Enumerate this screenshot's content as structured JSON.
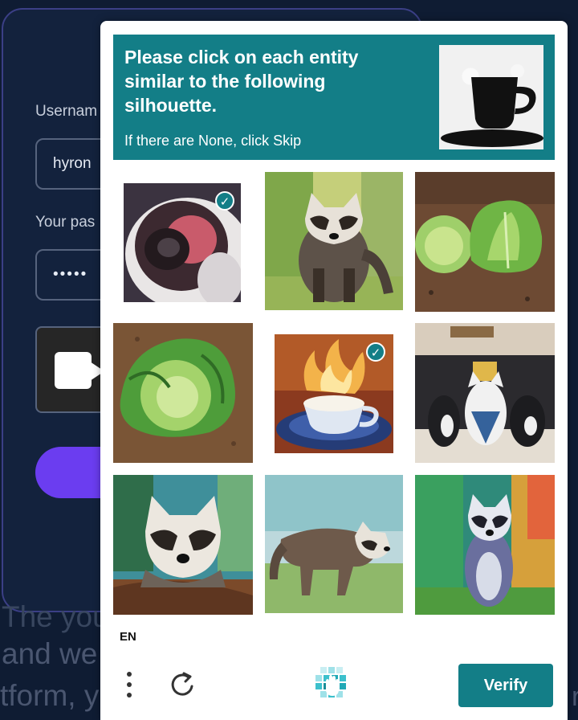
{
  "background": {
    "username_label": "Usernam",
    "username_value": "hyron",
    "password_label": "Your pas",
    "password_value": "•••••",
    "para_line1": "The you",
    "para_line2": "and we",
    "para_line3": "tform, y",
    "right_char": "r"
  },
  "captcha": {
    "prompt_title": "Please click on each entity similar to the following silhouette.",
    "prompt_subtitle": "If there are None, click Skip",
    "prompt_image_icon": "teacup-silhouette",
    "tiles": [
      {
        "subject": "cup-with-drink",
        "selected": true
      },
      {
        "subject": "raccoon",
        "selected": false
      },
      {
        "subject": "cabbage",
        "selected": false
      },
      {
        "subject": "cabbage",
        "selected": false
      },
      {
        "subject": "steaming-teacup",
        "selected": true
      },
      {
        "subject": "cats-on-couch",
        "selected": false
      },
      {
        "subject": "raccoon",
        "selected": false
      },
      {
        "subject": "raccoon",
        "selected": false
      },
      {
        "subject": "raccoon",
        "selected": false
      }
    ],
    "language": "EN",
    "verify_label": "Verify",
    "check_glyph": "✓"
  },
  "colors": {
    "accent": "#137e87",
    "background": "#0f1c33",
    "bg_button": "#6b3df0"
  }
}
